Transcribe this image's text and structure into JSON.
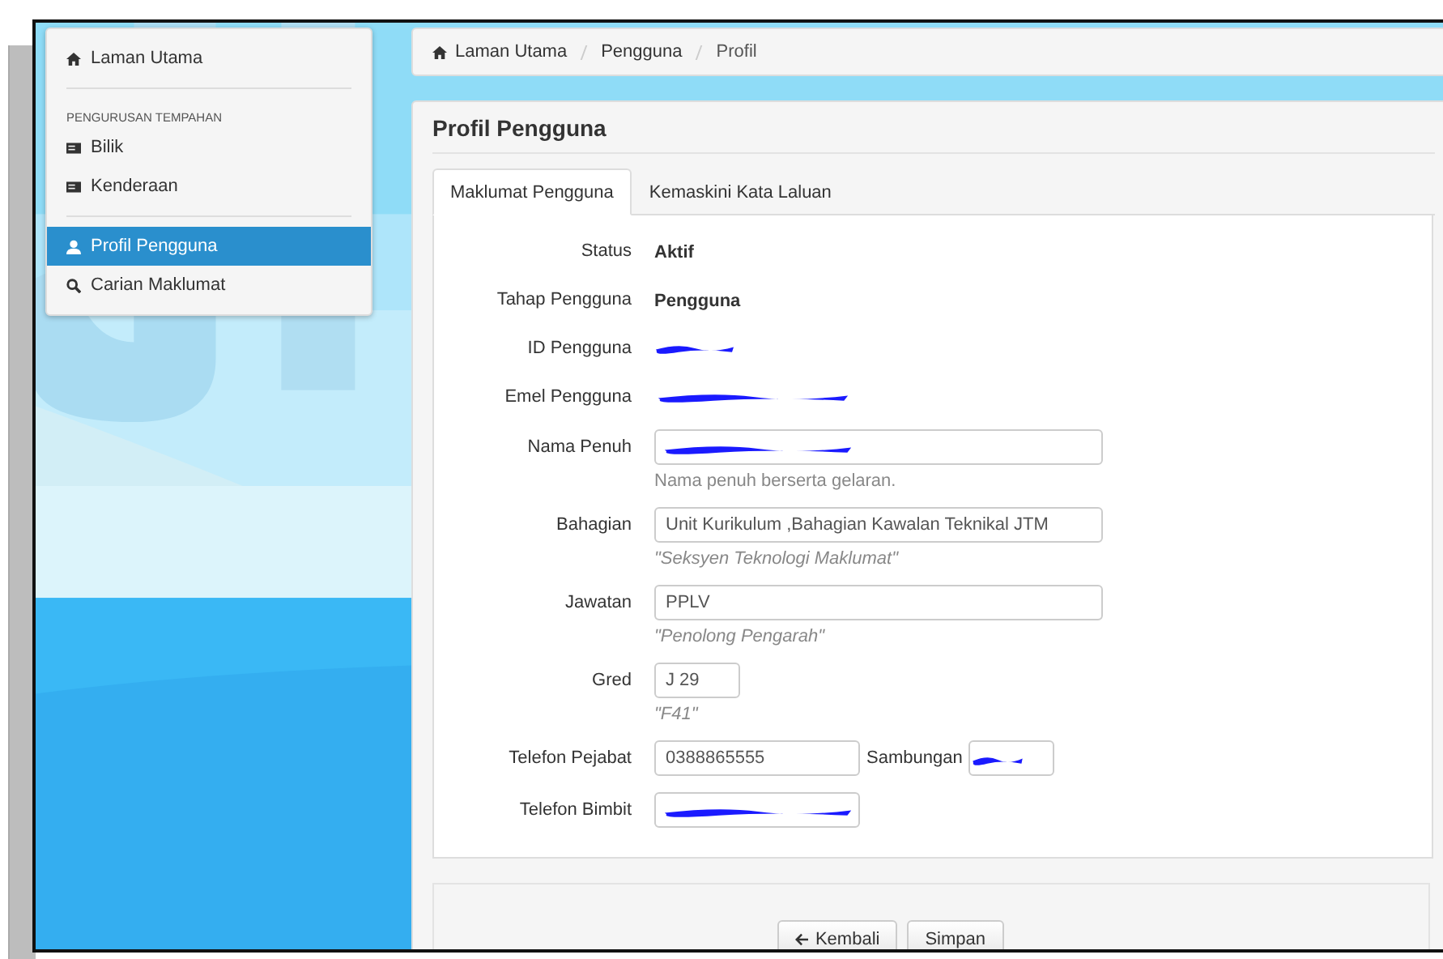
{
  "sidebar": {
    "sections": [
      {
        "items": [
          {
            "label": "Laman Utama",
            "selected": false
          }
        ]
      },
      {
        "header": "PENGURUSAN TEMPAHAN",
        "items": [
          {
            "label": "Bilik",
            "selected": false
          },
          {
            "label": "Kenderaan",
            "selected": false
          }
        ]
      },
      {
        "items": [
          {
            "label": "Profil Pengguna",
            "selected": true
          },
          {
            "label": "Carian Maklumat",
            "selected": false
          }
        ]
      }
    ]
  },
  "breadcrumb": [
    "Laman Utama",
    "Pengguna",
    "Profil"
  ],
  "panel": {
    "title": "Profil Pengguna",
    "tabs": [
      {
        "label": "Maklumat Pengguna",
        "selected": true
      },
      {
        "label": "Kemaskini Kata Laluan",
        "selected": false
      }
    ],
    "fields": [
      {
        "label": "Status",
        "kind": "text",
        "value": "Aktif",
        "redacted": false
      },
      {
        "label": "Tahap Pengguna",
        "kind": "text",
        "value": "Pengguna",
        "redacted": false
      },
      {
        "label": "ID Pengguna",
        "kind": "text",
        "redacted": true
      },
      {
        "label": "Emel Pengguna",
        "kind": "text",
        "redacted": true
      },
      {
        "label": "Nama Penuh",
        "kind": "wide",
        "redacted": true,
        "help": "Nama penuh berserta gelaran.",
        "italic": false
      },
      {
        "label": "Bahagian",
        "kind": "wide",
        "value": "Unit Kurikulum ,Bahagian Kawalan Teknikal JTM",
        "redacted": false,
        "help": "\"Seksyen Teknologi Maklumat\"",
        "italic": true
      },
      {
        "label": "Jawatan",
        "kind": "wide",
        "value": "PPLV",
        "redacted": false,
        "help": "\"Penolong Pengarah\"",
        "italic": true
      },
      {
        "label": "Gred",
        "kind": "short",
        "value": "J 29",
        "redacted": false,
        "help": "\"F41\"",
        "italic": true
      },
      {
        "label": "Telefon Pejabat",
        "kind": "medium",
        "value": "0388865555",
        "redacted": false,
        "extra": {
          "label": "Sambungan",
          "redacted": true
        }
      },
      {
        "label": "Telefon Bimbit",
        "kind": "medium",
        "redacted": true
      }
    ],
    "buttons": [
      "Kembali",
      "Simpan"
    ]
  }
}
